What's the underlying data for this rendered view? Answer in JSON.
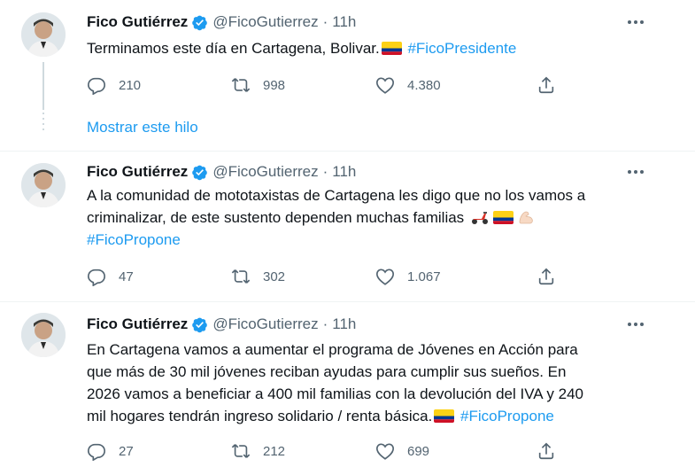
{
  "colors": {
    "accent": "#1d9bf0",
    "muted": "#536471",
    "text": "#0f1419",
    "border": "#eff3f4"
  },
  "tweets": [
    {
      "name": "Fico Gutiérrez",
      "handle": "@FicoGutierrez",
      "separator": "·",
      "time": "11h",
      "text_before": "Terminamos este día en Cartagena, Bolivar.",
      "hashtag": "#FicoPresidente",
      "replies": "210",
      "retweets": "998",
      "likes": "4.380"
    },
    {
      "name": "Fico Gutiérrez",
      "handle": "@FicoGutierrez",
      "separator": "·",
      "time": "11h",
      "line1": "A la comunidad de mototaxistas de Cartagena les digo que no los vamos a",
      "line2": "criminalizar, de este sustento dependen muchas familias",
      "hashtag": "#FicoPropone",
      "replies": "47",
      "retweets": "302",
      "likes": "1.067"
    },
    {
      "name": "Fico Gutiérrez",
      "handle": "@FicoGutierrez",
      "separator": "·",
      "time": "11h",
      "line1": "En Cartagena vamos a aumentar el programa de Jóvenes en Acción para",
      "line2": "que más de 30 mil jóvenes reciban ayudas para cumplir sus sueños. En",
      "line3": "2026 vamos a beneficiar a 400 mil familias con la devolución del IVA y 240",
      "line4": "mil hogares tendrán ingreso solidario / renta básica.",
      "hashtag": "#FicoPropone",
      "replies": "27",
      "retweets": "212",
      "likes": "699"
    }
  ],
  "show_thread": "Mostrar este hilo",
  "icons": [
    "reply-icon",
    "retweet-icon",
    "like-icon",
    "share-icon",
    "verified-icon",
    "more-icon",
    "colombia-flag-icon",
    "scooter-emoji",
    "flexed-biceps-emoji"
  ]
}
